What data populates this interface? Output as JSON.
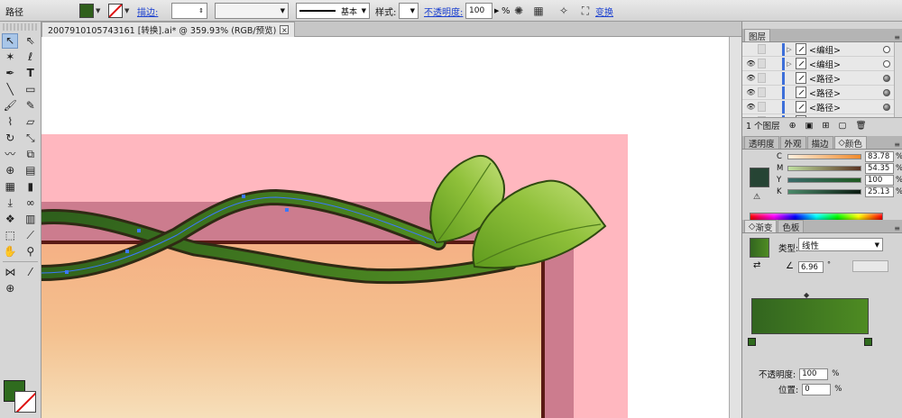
{
  "control_bar": {
    "object_type": "路径",
    "stroke_label": "描边:",
    "stroke_profile": "基本",
    "style_label": "样式:",
    "opacity_label": "不透明度:",
    "opacity_value": "100",
    "opacity_unit": "%",
    "transform_label": "变换"
  },
  "document": {
    "tab_title": "2007910105743161 [转换].ai* @ 359.93% (RGB/预览)",
    "close_glyph": "×"
  },
  "layers_panel": {
    "tab": "图层",
    "rows": [
      {
        "name": "<编组>",
        "expand": "▷",
        "target": "empty"
      },
      {
        "name": "<编组>",
        "expand": "▷",
        "target": "empty"
      },
      {
        "name": "<路径>",
        "expand": "",
        "target": "filled"
      },
      {
        "name": "<路径>",
        "expand": "",
        "target": "filled"
      },
      {
        "name": "<路径>",
        "expand": "",
        "target": "filled"
      },
      {
        "name": "<路径>",
        "expand": "",
        "target": "empty"
      }
    ],
    "footer": "1 个图层"
  },
  "color_panel": {
    "tabs": [
      "透明度",
      "外观",
      "描边",
      "颜色"
    ],
    "active_tab": "颜色",
    "channels": [
      {
        "label": "C",
        "value": "83.78"
      },
      {
        "label": "M",
        "value": "54.35"
      },
      {
        "label": "Y",
        "value": "100"
      },
      {
        "label": "K",
        "value": "25.13"
      }
    ],
    "percent": "%",
    "swatch_color": "#264434"
  },
  "gradient_panel": {
    "tabs": [
      "渐变",
      "色板"
    ],
    "active_tab": "渐变",
    "type_label": "类型:",
    "type_value": "线性",
    "angle_value": "6.96",
    "angle_unit": "°",
    "opacity_label": "不透明度:",
    "opacity_value": "100",
    "location_label": "位置:",
    "location_value": "0",
    "unit": "%",
    "start_color": "#32651f",
    "end_color": "#4e8b22"
  },
  "colors": {
    "accent_link": "#1a3fd0",
    "canvas_bg": "#ffffff"
  }
}
